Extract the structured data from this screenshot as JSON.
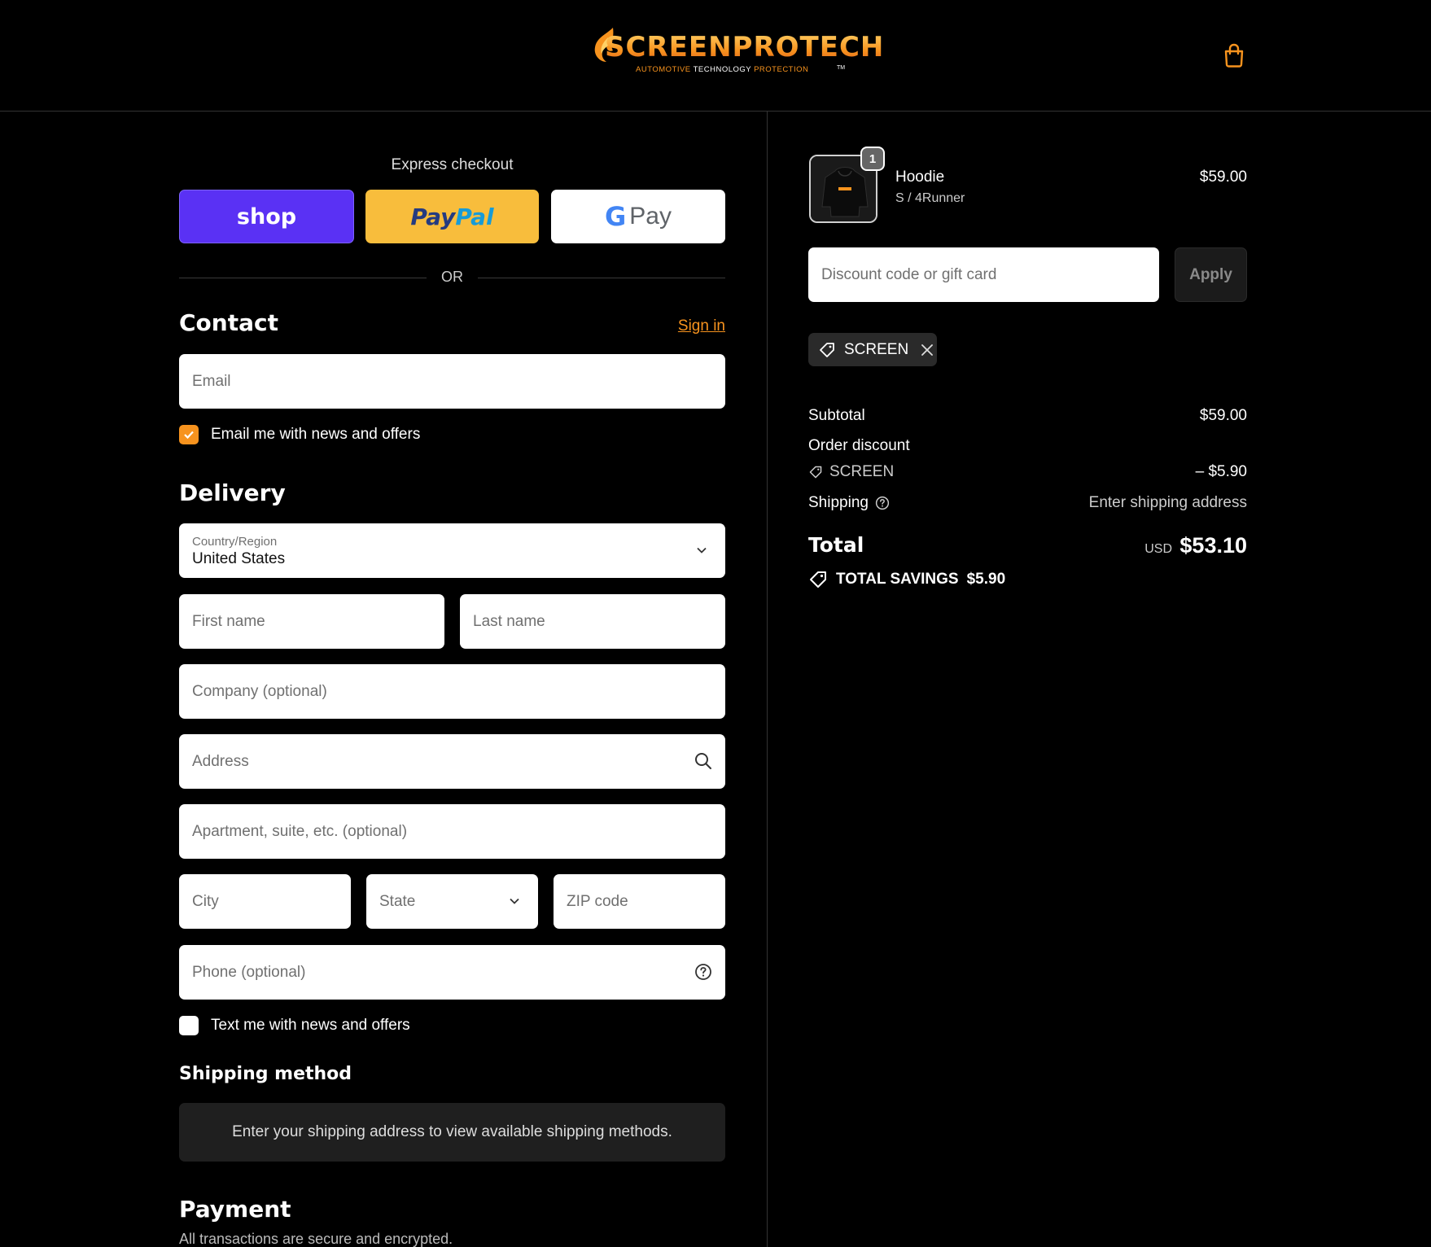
{
  "header": {
    "logo_text": "SCREENPROTECH",
    "logo_tag_left": "AUTOMOTIVE",
    "logo_tag_mid": "TECHNOLOGY",
    "logo_tag_right": "PROTECTION",
    "logo_tm": "TM",
    "cart_icon": "shopping-bag-icon",
    "accent_color": "#f7931e"
  },
  "express": {
    "title": "Express checkout",
    "shop_label": "shop",
    "paypal_label_1": "Pay",
    "paypal_label_2": "Pal",
    "gpay_g": "G",
    "gpay_label": "Pay",
    "or_label": "OR"
  },
  "contact": {
    "heading": "Contact",
    "signin_label": "Sign in",
    "email_placeholder": "Email",
    "news_checkbox_label": "Email me with news and offers",
    "news_checked": true
  },
  "delivery": {
    "heading": "Delivery",
    "country_label": "Country/Region",
    "country_value": "United States",
    "first_name_placeholder": "First name",
    "last_name_placeholder": "Last name",
    "company_placeholder": "Company (optional)",
    "address_placeholder": "Address",
    "apartment_placeholder": "Apartment, suite, etc. (optional)",
    "city_placeholder": "City",
    "state_placeholder": "State",
    "zip_placeholder": "ZIP code",
    "phone_placeholder": "Phone (optional)",
    "text_checkbox_label": "Text me with news and offers",
    "text_checked": false
  },
  "shipping_method": {
    "heading": "Shipping method",
    "info": "Enter your shipping address to view available shipping methods."
  },
  "payment": {
    "heading": "Payment",
    "subtitle": "All transactions are secure and encrypted."
  },
  "order": {
    "item": {
      "name": "Hoodie",
      "variant": "S / 4Runner",
      "price": "$59.00",
      "quantity": "1"
    },
    "discount_placeholder": "Discount code or gift card",
    "apply_label": "Apply",
    "applied_code": "SCREEN",
    "subtotal_label": "Subtotal",
    "subtotal_value": "$59.00",
    "order_discount_label": "Order discount",
    "discount_code": "SCREEN",
    "discount_value": "– $5.90",
    "shipping_label": "Shipping",
    "shipping_value": "Enter shipping address",
    "total_label": "Total",
    "total_currency": "USD",
    "total_value": "$53.10",
    "savings_label": "TOTAL SAVINGS",
    "savings_value": "$5.90"
  }
}
